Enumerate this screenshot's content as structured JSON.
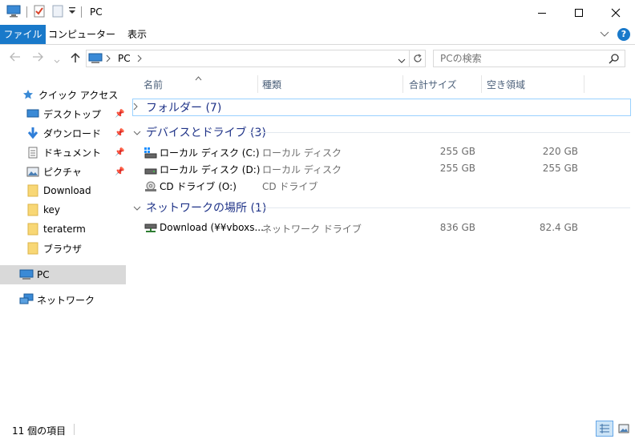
{
  "window": {
    "title": "PC",
    "minimize_icon": "minimize-icon",
    "maximize_icon": "maximize-icon",
    "close_icon": "close-icon"
  },
  "ribbon": {
    "tabs": [
      {
        "label": "ファイル",
        "active": true
      },
      {
        "label": "コンピューター",
        "active": false
      },
      {
        "label": "表示",
        "active": false
      }
    ],
    "help_label": "?"
  },
  "address": {
    "path_label": "PC",
    "search_placeholder": "PCの検索"
  },
  "columns": {
    "name": "名前",
    "type": "種類",
    "total": "合計サイズ",
    "free": "空き領域"
  },
  "sidebar": {
    "quick_access": "クイック アクセス",
    "items": [
      {
        "label": "デスクトップ",
        "icon": "desktop-icon",
        "pinned": true
      },
      {
        "label": "ダウンロード",
        "icon": "download-arrow-icon",
        "pinned": true
      },
      {
        "label": "ドキュメント",
        "icon": "document-icon",
        "pinned": true
      },
      {
        "label": "ピクチャ",
        "icon": "pictures-icon",
        "pinned": true
      },
      {
        "label": "Download",
        "icon": "folder-icon",
        "pinned": false
      },
      {
        "label": "key",
        "icon": "folder-icon",
        "pinned": false
      },
      {
        "label": "teraterm",
        "icon": "folder-icon",
        "pinned": false
      },
      {
        "label": "ブラウザ",
        "icon": "folder-icon",
        "pinned": false
      }
    ],
    "pc": "PC",
    "network": "ネットワーク"
  },
  "groups": {
    "folders": "フォルダー (7)",
    "devices": "デバイスとドライブ (3)",
    "network": "ネットワークの場所 (1)"
  },
  "drives": [
    {
      "name": "ローカル ディスク (C:)",
      "type": "ローカル ディスク",
      "total": "255 GB",
      "free": "220 GB",
      "icon": "system-drive-icon"
    },
    {
      "name": "ローカル ディスク (D:)",
      "type": "ローカル ディスク",
      "total": "255 GB",
      "free": "255 GB",
      "icon": "hard-drive-icon"
    },
    {
      "name": "CD ドライブ (O:)",
      "type": "CD ドライブ",
      "total": "",
      "free": "",
      "icon": "cd-drive-icon"
    }
  ],
  "network_locations": [
    {
      "name": "Download (¥¥vboxs...",
      "type": "ネットワーク ドライブ",
      "total": "836 GB",
      "free": "82.4 GB",
      "icon": "network-drive-icon"
    }
  ],
  "status": {
    "item_count": "11 個の項目"
  },
  "colors": {
    "accent": "#1979ca",
    "group_text": "#1e3287",
    "selected_bg": "#d9d9d9"
  }
}
